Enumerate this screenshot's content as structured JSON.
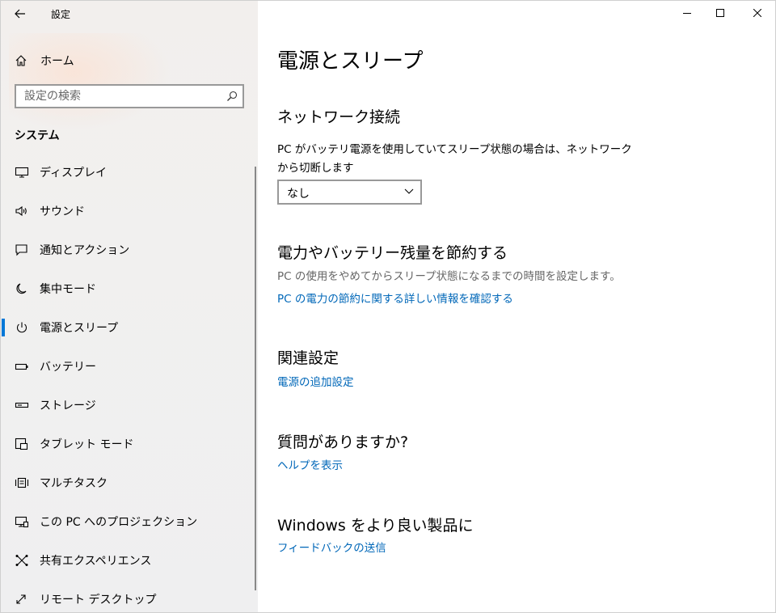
{
  "window": {
    "title": "設定",
    "controls": [
      "minimize-icon",
      "maximize-icon",
      "close-icon"
    ]
  },
  "sidebar": {
    "home_label": "ホーム",
    "search_placeholder": "設定の検索",
    "section_label": "システム",
    "items": [
      {
        "label": "ディスプレイ",
        "icon": "display-icon",
        "selected": false
      },
      {
        "label": "サウンド",
        "icon": "speaker-icon",
        "selected": false
      },
      {
        "label": "通知とアクション",
        "icon": "notification-icon",
        "selected": false
      },
      {
        "label": "集中モード",
        "icon": "moon-icon",
        "selected": false
      },
      {
        "label": "電源とスリープ",
        "icon": "power-icon",
        "selected": true
      },
      {
        "label": "バッテリー",
        "icon": "battery-icon",
        "selected": false
      },
      {
        "label": "ストレージ",
        "icon": "storage-icon",
        "selected": false
      },
      {
        "label": "タブレット モード",
        "icon": "tablet-icon",
        "selected": false
      },
      {
        "label": "マルチタスク",
        "icon": "multitask-icon",
        "selected": false
      },
      {
        "label": "この PC へのプロジェクション",
        "icon": "projection-icon",
        "selected": false
      },
      {
        "label": "共有エクスペリエンス",
        "icon": "shared-icon",
        "selected": false
      },
      {
        "label": "リモート デスクトップ",
        "icon": "remote-desktop-icon",
        "selected": false
      }
    ]
  },
  "main": {
    "page_title": "電源とスリープ",
    "network": {
      "heading": "ネットワーク接続",
      "description": "PC がバッテリ電源を使用していてスリープ状態の場合は、ネットワークから切断します",
      "dropdown_value": "なし"
    },
    "save": {
      "heading": "電力やバッテリー残量を節約する",
      "description": "PC の使用をやめてからスリープ状態になるまでの時間を設定します。",
      "link": "PC の電力の節約に関する詳しい情報を確認する"
    },
    "related": {
      "heading": "関連設定",
      "link": "電源の追加設定"
    },
    "help": {
      "heading": "質問がありますか?",
      "link": "ヘルプを表示"
    },
    "feedback": {
      "heading": "Windows をより良い製品に",
      "link": "フィードバックの送信"
    }
  },
  "colors": {
    "accent": "#0078d7",
    "link": "#0067b8",
    "sidebar_bg": "#f0efee"
  }
}
